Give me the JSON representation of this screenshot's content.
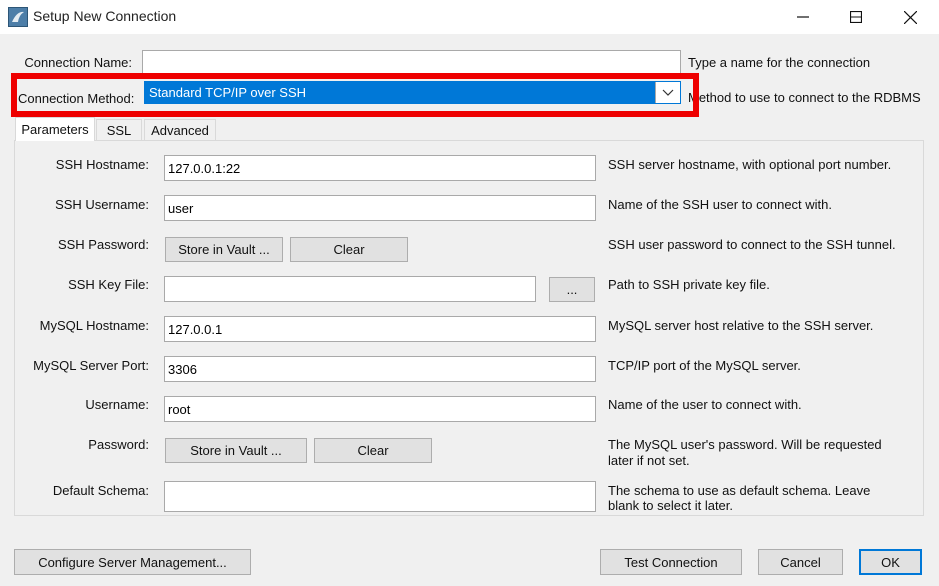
{
  "window": {
    "title": "Setup New Connection",
    "minimize": "minimize",
    "maximize": "maximize",
    "close": "close"
  },
  "connection_name": {
    "label": "Connection Name:",
    "value": "",
    "hint": "Type a name for the connection"
  },
  "connection_method": {
    "label": "Connection Method:",
    "value": "Standard TCP/IP over SSH",
    "hint": "Method to use to connect to the RDBMS"
  },
  "tabs": [
    "Parameters",
    "SSL",
    "Advanced"
  ],
  "params": {
    "ssh_hostname": {
      "label": "SSH Hostname:",
      "value": "127.0.0.1:22",
      "hint": "SSH server hostname, with  optional port number."
    },
    "ssh_username": {
      "label": "SSH Username:",
      "value": "user",
      "hint": "Name of the SSH user to connect with."
    },
    "ssh_password": {
      "label": "SSH Password:",
      "store": "Store in Vault ...",
      "clear": "Clear",
      "hint": "SSH user password to connect to the SSH tunnel."
    },
    "ssh_key_file": {
      "label": "SSH Key File:",
      "value": "",
      "browse": "...",
      "hint": "Path to SSH private key file."
    },
    "mysql_hostname": {
      "label": "MySQL Hostname:",
      "value": "127.0.0.1",
      "hint": "MySQL server host relative to the SSH server."
    },
    "mysql_port": {
      "label": "MySQL Server Port:",
      "value": "3306",
      "hint": "TCP/IP port of the MySQL server."
    },
    "username": {
      "label": "Username:",
      "value": "root",
      "hint": "Name of the user to connect with."
    },
    "password": {
      "label": "Password:",
      "store": "Store in Vault ...",
      "clear": "Clear",
      "hint1": "The MySQL user's password. Will be requested",
      "hint2": "later if not set."
    },
    "default_schema": {
      "label": "Default Schema:",
      "value": "",
      "hint1": "The schema to use as default schema. Leave",
      "hint2": "blank to select it later."
    }
  },
  "footer": {
    "configure": "Configure Server Management...",
    "test": "Test Connection",
    "cancel": "Cancel",
    "ok": "OK"
  },
  "colors": {
    "highlight": "#ee0000",
    "selection": "#0078d7"
  }
}
